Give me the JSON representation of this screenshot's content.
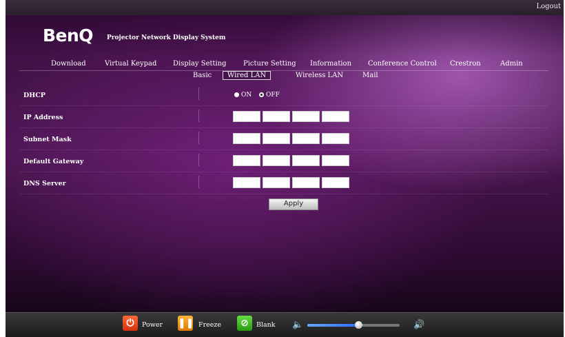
{
  "header": {
    "logout_label": "Logout",
    "logo": "BenQ",
    "system_title": "Projector Network Display System"
  },
  "nav": {
    "items": [
      "Download",
      "Virtual Keypad",
      "Display Setting",
      "Picture Setting",
      "Information",
      "Conference Control",
      "Crestron",
      "Admin"
    ]
  },
  "subnav": {
    "items": [
      "Basic",
      "Wired LAN",
      "Wireless LAN",
      "Mail"
    ],
    "active": "Wired LAN"
  },
  "form": {
    "dhcp_label": "DHCP",
    "dhcp_on_label": "ON",
    "dhcp_off_label": "OFF",
    "dhcp_value": "OFF",
    "ip_label": "IP Address",
    "subnet_label": "Subnet Mask",
    "gateway_label": "Default Gateway",
    "dns_label": "DNS Server",
    "apply_label": "Apply"
  },
  "footer": {
    "power_label": "Power",
    "freeze_label": "Freeze",
    "blank_label": "Blank",
    "volume_level": 0.55,
    "icons": {
      "power": "power-icon",
      "freeze": "pause-icon",
      "blank": "blank-screen-icon",
      "vol_low": "volume-low-icon",
      "vol_high": "volume-high-icon"
    }
  },
  "colors": {
    "background": "#3a0e3f",
    "power": "#e0401a",
    "freeze": "#f09a10",
    "blank": "#44bb22",
    "volume": "#3a8cff"
  }
}
